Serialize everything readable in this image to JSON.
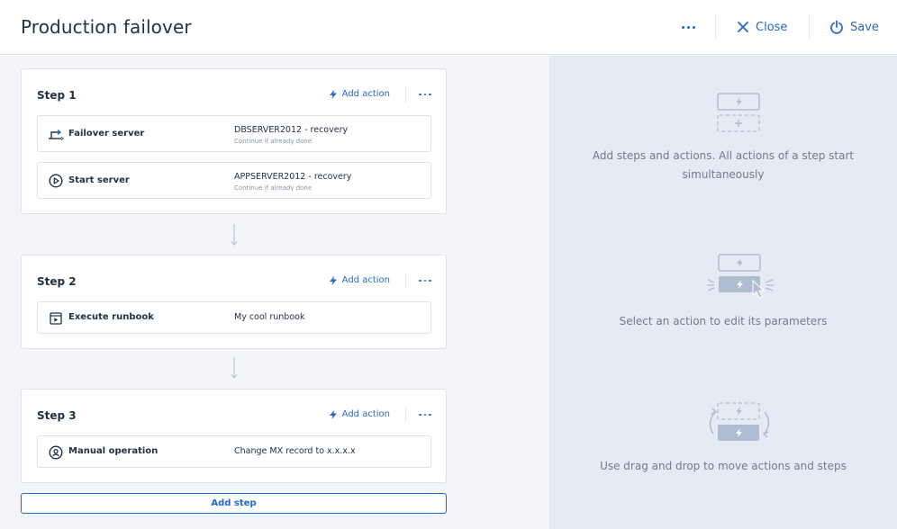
{
  "header": {
    "title": "Production failover",
    "close_label": "Close",
    "save_label": "Save"
  },
  "steps": [
    {
      "title": "Step 1",
      "add_action_label": "Add action",
      "actions": [
        {
          "name": "Failover server",
          "value": "DBSERVER2012 - recovery",
          "sub": "Continue if already done",
          "icon": "failover-icon"
        },
        {
          "name": "Start server",
          "value": "APPSERVER2012 - recovery",
          "sub": "Continue if already done",
          "icon": "play-circle-icon"
        }
      ]
    },
    {
      "title": "Step 2",
      "add_action_label": "Add action",
      "actions": [
        {
          "name": "Execute runbook",
          "value": "My cool runbook",
          "icon": "runbook-icon"
        }
      ]
    },
    {
      "title": "Step 3",
      "add_action_label": "Add action",
      "actions": [
        {
          "name": "Manual operation",
          "value": "Change MX record to x.x.x.x",
          "icon": "manual-operation-icon"
        }
      ]
    }
  ],
  "add_step_label": "Add step",
  "hints": [
    "Add steps and actions. All actions of a step start simultaneously",
    "Select an action to edit its parameters",
    "Use drag and drop to move actions and steps"
  ],
  "colors": {
    "accent": "#2668c5",
    "panel_bg": "#f3f5f8",
    "hint_bg": "#e5ebf3"
  }
}
